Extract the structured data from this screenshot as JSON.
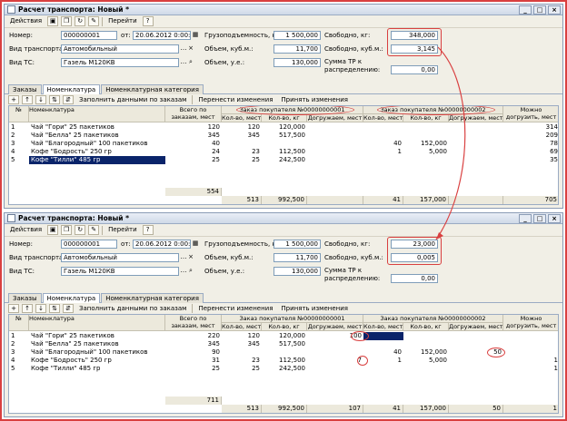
{
  "colors": {
    "accent": "#d94040",
    "selection": "#0a246a"
  },
  "windows": [
    {
      "title": "Расчет транспорта: Новый *",
      "toolbar": {
        "actions": "Действия",
        "goto": "Перейти"
      },
      "form": {
        "number_label": "Номер:",
        "number": "000000001",
        "from_label": "от:",
        "date": "20.06.2012 0:00:00",
        "capacity_label": "Грузоподъемность, кг:",
        "capacity": "1 500,000",
        "free_kg_label": "Свободно, кг:",
        "free_kg": "348,000",
        "transport_type_label": "Вид транспорта:",
        "transport_type": "Автомобильный",
        "volume_m3_label": "Объем, куб.м.:",
        "volume_m3": "11,700",
        "free_m3_label": "Свободно, куб.м.:",
        "free_m3": "3,145",
        "vehicle_label": "Вид ТС:",
        "vehicle": "Газель М120КВ",
        "volume_units_label": "Объем, у.е.:",
        "volume_units": "130,000",
        "sum_label": "Сумма ТР к распределению:",
        "sum": "0,00"
      },
      "tabs": [
        "Заказы",
        "Номенклатура",
        "Номенклатурная категория"
      ],
      "subtoolbar": {
        "fill": "Заполнить данными по заказам",
        "transfer": "Перенести изменения",
        "accept": "Принять изменения"
      },
      "grid": {
        "headers": {
          "num": "№",
          "item": "Номенклатура",
          "total": "Всего по заказам, мест",
          "order1": "Заказ покупателя №00000000001",
          "order2": "Заказ покупателя №00000000002",
          "qty_places": "Кол-во, мест",
          "qty_weight": "Кол-во, кг",
          "add_places": "Догружаем, мест",
          "can_load": "Можно догрузить, мест"
        },
        "rows": [
          {
            "n": "1",
            "item": "Чай \"Гори\" 25 пакетиков",
            "total": "120",
            "o1p": "120",
            "o1w": "120,000",
            "o1a": "",
            "o2p": "",
            "o2w": "",
            "o2a": "",
            "can": "314"
          },
          {
            "n": "2",
            "item": "Чай \"Белла\" 25 пакетиков",
            "total": "345",
            "o1p": "345",
            "o1w": "517,500",
            "o1a": "",
            "o2p": "",
            "o2w": "",
            "o2a": "",
            "can": "209"
          },
          {
            "n": "3",
            "item": "Чай \"Благородный\" 100 пакетиков",
            "total": "40",
            "o1p": "",
            "o1w": "",
            "o1a": "",
            "o2p": "40",
            "o2w": "152,000",
            "o2a": "",
            "can": "78"
          },
          {
            "n": "4",
            "item": "Кофе \"Бодрость\" 250 гр",
            "total": "24",
            "o1p": "23",
            "o1w": "112,500",
            "o1a": "",
            "o2p": "1",
            "o2w": "5,000",
            "o2a": "",
            "can": "69"
          },
          {
            "n": "5",
            "item": "Кофе \"Тилли\" 485 гр",
            "total": "25",
            "o1p": "25",
            "o1w": "242,500",
            "o1a": "",
            "o2p": "",
            "o2w": "",
            "o2a": "",
            "can": "35"
          }
        ],
        "footer": {
          "total": "554",
          "o1p": "513",
          "o1w": "992,500",
          "o1a": "",
          "o2p": "41",
          "o2w": "157,000",
          "o2a": "",
          "can": "705"
        }
      }
    },
    {
      "title": "Расчет транспорта: Новый *",
      "toolbar": {
        "actions": "Действия",
        "goto": "Перейти"
      },
      "form": {
        "number_label": "Номер:",
        "number": "000000001",
        "from_label": "от:",
        "date": "20.06.2012 0:00:00",
        "capacity_label": "Грузоподъемность, кг:",
        "capacity": "1 500,000",
        "free_kg_label": "Свободно, кг:",
        "free_kg": "23,000",
        "transport_type_label": "Вид транспорта:",
        "transport_type": "Автомобильный",
        "volume_m3_label": "Объем, куб.м.:",
        "volume_m3": "11,700",
        "free_m3_label": "Свободно, куб.м.:",
        "free_m3": "0,005",
        "vehicle_label": "Вид ТС:",
        "vehicle": "Газель М120КВ",
        "volume_units_label": "Объем, у.е.:",
        "volume_units": "130,000",
        "sum_label": "Сумма ТР к распределению:",
        "sum": "0,00"
      },
      "tabs": [
        "Заказы",
        "Номенклатура",
        "Номенклатурная категория"
      ],
      "subtoolbar": {
        "fill": "Заполнить данными по заказам",
        "transfer": "Перенести изменения",
        "accept": "Принять изменения"
      },
      "grid": {
        "headers": {
          "num": "№",
          "item": "Номенклатура",
          "total": "Всего по заказам, мест",
          "order1": "Заказ покупателя №00000000001",
          "order2": "Заказ покупателя №00000000002",
          "qty_places": "Кол-во, мест",
          "qty_weight": "Кол-во, кг",
          "add_places": "Догружаем, мест",
          "can_load": "Можно догрузить, мест"
        },
        "rows": [
          {
            "n": "1",
            "item": "Чай \"Гори\" 25 пакетиков",
            "total": "220",
            "o1p": "120",
            "o1w": "120,000",
            "o1a": "100",
            "o2p": "",
            "o2w": "",
            "o2a": "",
            "can": ""
          },
          {
            "n": "2",
            "item": "Чай \"Белла\" 25 пакетиков",
            "total": "345",
            "o1p": "345",
            "o1w": "517,500",
            "o1a": "",
            "o2p": "",
            "o2w": "",
            "o2a": "",
            "can": ""
          },
          {
            "n": "3",
            "item": "Чай \"Благородный\" 100 пакетиков",
            "total": "90",
            "o1p": "",
            "o1w": "",
            "o1a": "",
            "o2p": "40",
            "o2w": "152,000",
            "o2a": "50",
            "can": ""
          },
          {
            "n": "4",
            "item": "Кофе \"Бодрость\" 250 гр",
            "total": "31",
            "o1p": "23",
            "o1w": "112,500",
            "o1a": "7",
            "o2p": "1",
            "o2w": "5,000",
            "o2a": "",
            "can": "1"
          },
          {
            "n": "5",
            "item": "Кофе \"Тилли\" 485 гр",
            "total": "25",
            "o1p": "25",
            "o1w": "242,500",
            "o1a": "",
            "o2p": "",
            "o2w": "",
            "o2a": "",
            "can": "1"
          }
        ],
        "footer": {
          "total": "711",
          "o1p": "513",
          "o1w": "992,500",
          "o1a": "107",
          "o2p": "41",
          "o2w": "157,000",
          "o2a": "50",
          "can": "1"
        }
      }
    }
  ]
}
